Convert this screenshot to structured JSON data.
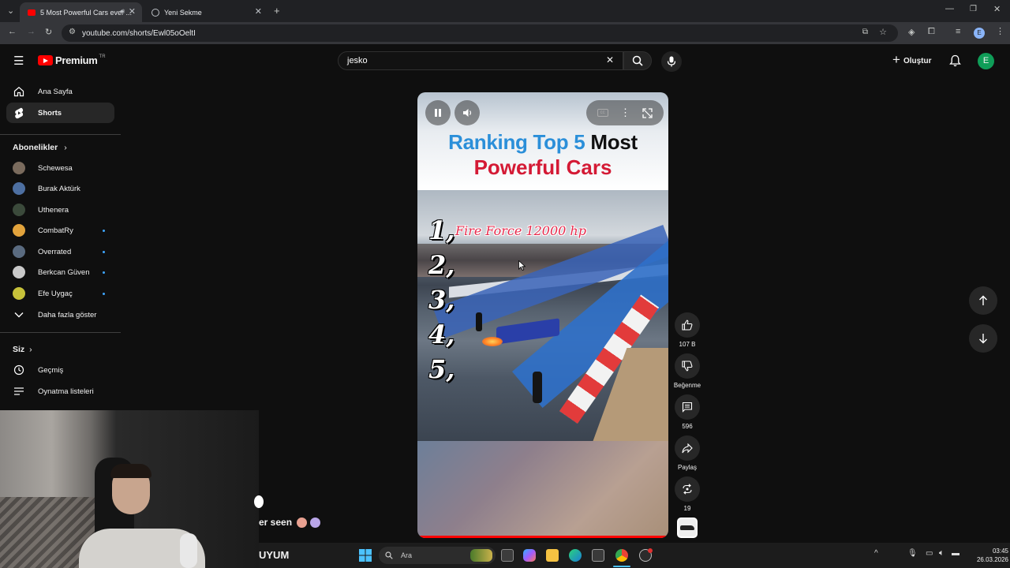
{
  "browser": {
    "tabs": [
      {
        "title": "5 Most Powerful Cars ever ...",
        "active": true
      },
      {
        "title": "Yeni Sekme",
        "active": false
      }
    ],
    "url": "youtube.com/shorts/Ewl05oOeltI"
  },
  "header": {
    "logo_text": "Premium",
    "country": "TR",
    "search_value": "jesko",
    "create_label": "Oluştur",
    "avatar_letter": "E"
  },
  "sidebar": {
    "main": [
      {
        "label": "Ana Sayfa",
        "icon": "home-icon"
      },
      {
        "label": "Shorts",
        "icon": "shorts-icon"
      }
    ],
    "subscriptions_title": "Abonelikler",
    "subscriptions": [
      {
        "label": "Schewesa",
        "color": "#7a6b5d",
        "dot": false
      },
      {
        "label": "Burak Aktürk",
        "color": "#4d6fa1",
        "dot": false
      },
      {
        "label": "Uthenera",
        "color": "#3b4a3b",
        "dot": false
      },
      {
        "label": "CombatRy",
        "color": "#e2a33c",
        "dot": true
      },
      {
        "label": "Overrated",
        "color": "#5a6b80",
        "dot": true
      },
      {
        "label": "Berkcan Güven",
        "color": "#c9c9c9",
        "dot": true
      },
      {
        "label": "Efe Uygaç",
        "color": "#c7c23a",
        "dot": true
      }
    ],
    "show_more": "Daha fazla göster",
    "you_title": "Siz",
    "you_items": [
      {
        "label": "Geçmiş",
        "icon": "history-icon"
      },
      {
        "label": "Oynatma listeleri",
        "icon": "playlist-icon"
      }
    ]
  },
  "short": {
    "title_line1_blue": "Ranking Top 5",
    "title_line1_black": "Most",
    "title_line2": "Powerful Cars",
    "ranks": [
      "1,",
      "2,",
      "3,",
      "4,",
      "5,"
    ],
    "rank1_label": "Fire Force 12000 hp",
    "progress": 0.99
  },
  "actions": {
    "likes": "107 B",
    "dislike_label": "Beğenme",
    "comments": "596",
    "share_label": "Paylaş",
    "remix_count": "19"
  },
  "overlay_caption": "er seen",
  "overlay_bottom": "UYUM",
  "taskbar": {
    "search_placeholder": "Ara",
    "time": "03:45",
    "date": "26.03.2026"
  }
}
